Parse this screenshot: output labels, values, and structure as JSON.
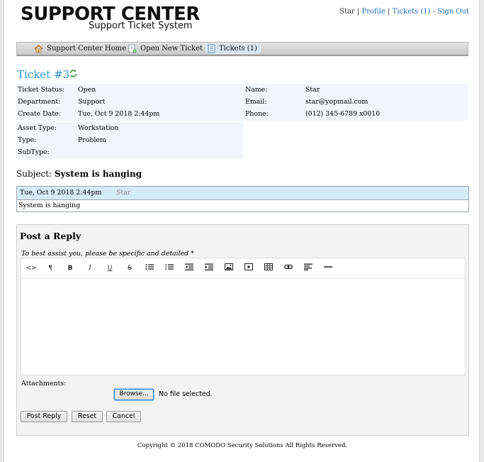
{
  "header": {
    "title": "SUPPORT CENTER",
    "subtitle": "Support Ticket System"
  },
  "userbar": {
    "username": "Star",
    "profile": "Profile",
    "tickets": "Tickets (1)",
    "signout": "Sign Out",
    "separator": "|",
    "dash": "-"
  },
  "nav": {
    "items": [
      {
        "label": "Support Center Home",
        "icon": "home-icon"
      },
      {
        "label": "Open New Ticket",
        "icon": "new-ticket-icon"
      },
      {
        "label": "Tickets (1)",
        "icon": "tickets-icon"
      }
    ]
  },
  "ticket": {
    "number": "Ticket #3",
    "status_label": "Ticket Status:",
    "status": "Open",
    "department_label": "Department:",
    "department": "Support",
    "created_label": "Create Date:",
    "created": "Tue, Oct 9 2018 2:44pm",
    "name_label": "Name:",
    "name": "Star",
    "email_label": "Email:",
    "email": "star@yopmail.com",
    "phone_label": "Phone:",
    "phone": "(012) 345-6789 x0010",
    "asset_label": "Asset Type:",
    "asset": "Workstation",
    "type_label": "Type:",
    "type": "Problem",
    "subtype_label": "SubType:",
    "subtype": ""
  },
  "subject": {
    "label": "Subject:",
    "value": "System is hanging"
  },
  "thread": {
    "date": "Tue, Oct 9 2018 2:44pm",
    "author": "Star",
    "message": "System is hanging"
  },
  "reply": {
    "title": "Post a Reply",
    "hint": "To best assist you, please be specific and detailed *",
    "toolbar": {
      "bold": "B",
      "italic": "I",
      "underline": "U",
      "strike": "S",
      "paragraph": "¶",
      "code": "<>"
    },
    "attachments_label": "Attachments:",
    "browse": "Browse...",
    "no_file": "No file selected.",
    "post_button": "Post Reply",
    "reset_button": "Reset",
    "cancel_button": "Cancel"
  },
  "footer": {
    "copyright": "Copyright © 2018 COMODO Security Solutions All Rights Reserved."
  },
  "colors": {
    "link": "#1b6fb8",
    "ticket_title": "#2a99d3",
    "info_bg": "#f2f6fb",
    "thread_header_bg": "#d6ebf8"
  }
}
